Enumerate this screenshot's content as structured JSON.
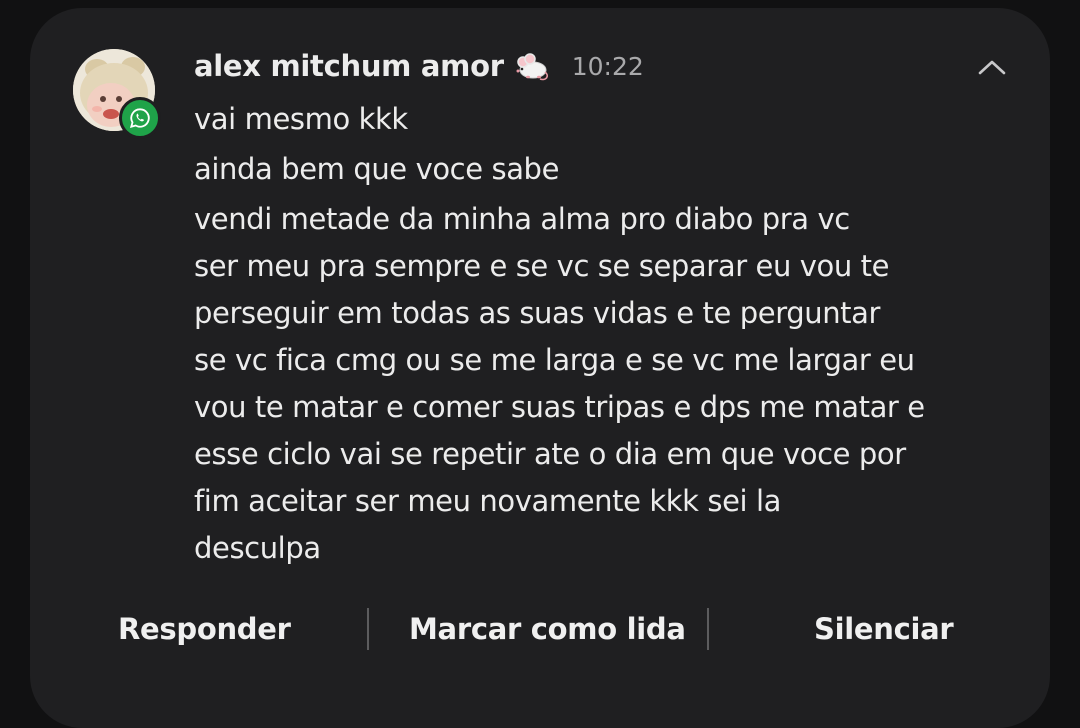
{
  "notification": {
    "sender": "alex mitchum amor",
    "sender_emoji": "mouse-emoji",
    "time": "10:22",
    "app_icon": "whatsapp-icon",
    "collapse_icon": "chevron-up-icon",
    "messages": [
      "vai mesmo kkk",
      "ainda bem que voce sabe",
      "vendi metade da minha alma pro diabo pra vc",
      "ser meu pra sempre e se vc se separar eu vou te",
      "perseguir em todas as suas vidas e te perguntar",
      "se vc fica cmg ou se me larga e se vc me largar eu",
      "vou te matar e comer suas tripas e dps me matar e",
      "esse ciclo vai se repetir ate o dia em que voce por",
      "fim aceitar ser meu novamente kkk sei la",
      "desculpa"
    ]
  },
  "actions": {
    "reply": "Responder",
    "mark_read": "Marcar como lida",
    "mute": "Silenciar"
  },
  "colors": {
    "background": "#111112",
    "card": "#1f1f21",
    "text": "#ececec",
    "muted_text": "#a9a9ab",
    "whatsapp_green": "#1fa349"
  }
}
